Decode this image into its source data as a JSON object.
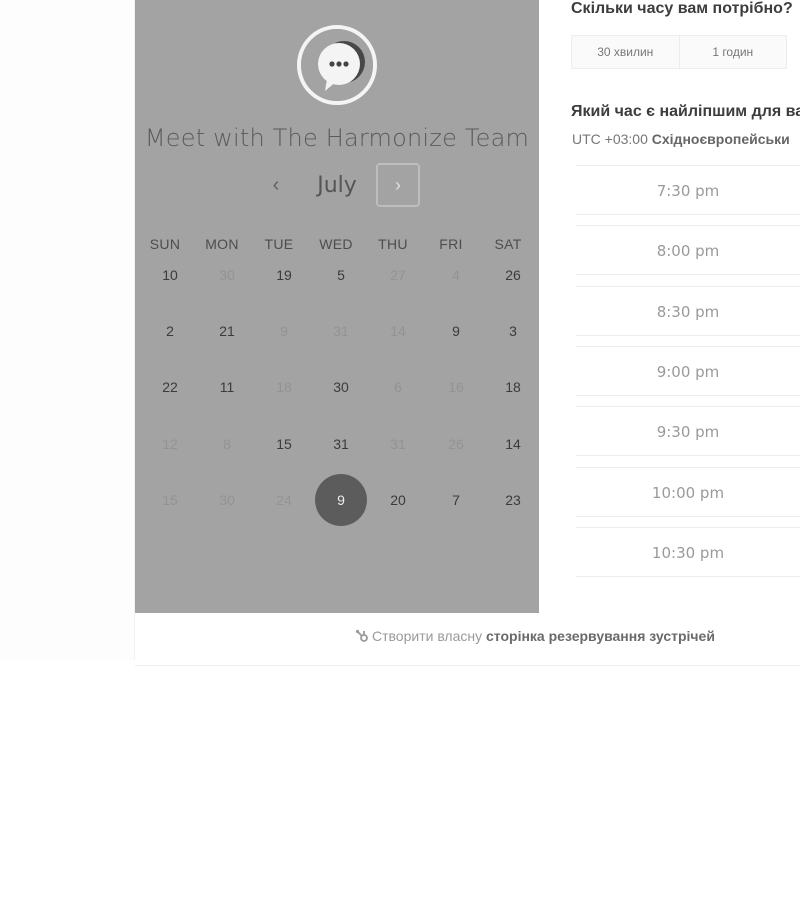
{
  "calendar": {
    "title": "Meet with The Harmonize Team",
    "month": "July",
    "prev_icon": "‹",
    "next_icon": "›",
    "weekdays": [
      "SUN",
      "MON",
      "TUE",
      "WED",
      "THU",
      "FRI",
      "SAT"
    ],
    "weeks": [
      [
        "10",
        "30",
        "19",
        "5",
        "27",
        "4",
        "26"
      ],
      [
        "2",
        "21",
        "9",
        "31",
        "14",
        "9",
        "3"
      ],
      [
        "22",
        "11",
        "18",
        "30",
        "6",
        "16",
        "18"
      ],
      [
        "12",
        "8",
        "15",
        "31",
        "31",
        "26",
        "14"
      ],
      [
        "15",
        "30",
        "24",
        "9",
        "20",
        "7",
        "23"
      ]
    ],
    "muted_days": [
      [
        0,
        1
      ],
      [
        0,
        4
      ],
      [
        0,
        5
      ],
      [
        1,
        2
      ],
      [
        1,
        3
      ],
      [
        1,
        4
      ],
      [
        2,
        2
      ],
      [
        2,
        4
      ],
      [
        2,
        5
      ],
      [
        3,
        0
      ],
      [
        3,
        1
      ],
      [
        3,
        4
      ],
      [
        3,
        5
      ],
      [
        4,
        0
      ],
      [
        4,
        1
      ],
      [
        4,
        2
      ]
    ],
    "selected_day": [
      4,
      3
    ]
  },
  "duration": {
    "title": "Скільки часу вам потрібно?",
    "options": [
      "30 хвилин",
      "1 годин"
    ]
  },
  "time_select": {
    "title": "Який час є найліпшим для ва",
    "timezone_offset": "UTC +03:00 ",
    "timezone_name": "Східноєвропейськи",
    "slots": [
      "7:30 pm",
      "8:00 pm",
      "8:30 pm",
      "9:00 pm",
      "9:30 pm",
      "10:00 pm",
      "10:30 pm"
    ]
  },
  "footer": {
    "prefix": "Створити власну ",
    "link": "сторінка резервування зустрічей"
  },
  "colors": {
    "panel": "#a3a3a3",
    "selected_day": "#5c5c5c"
  }
}
